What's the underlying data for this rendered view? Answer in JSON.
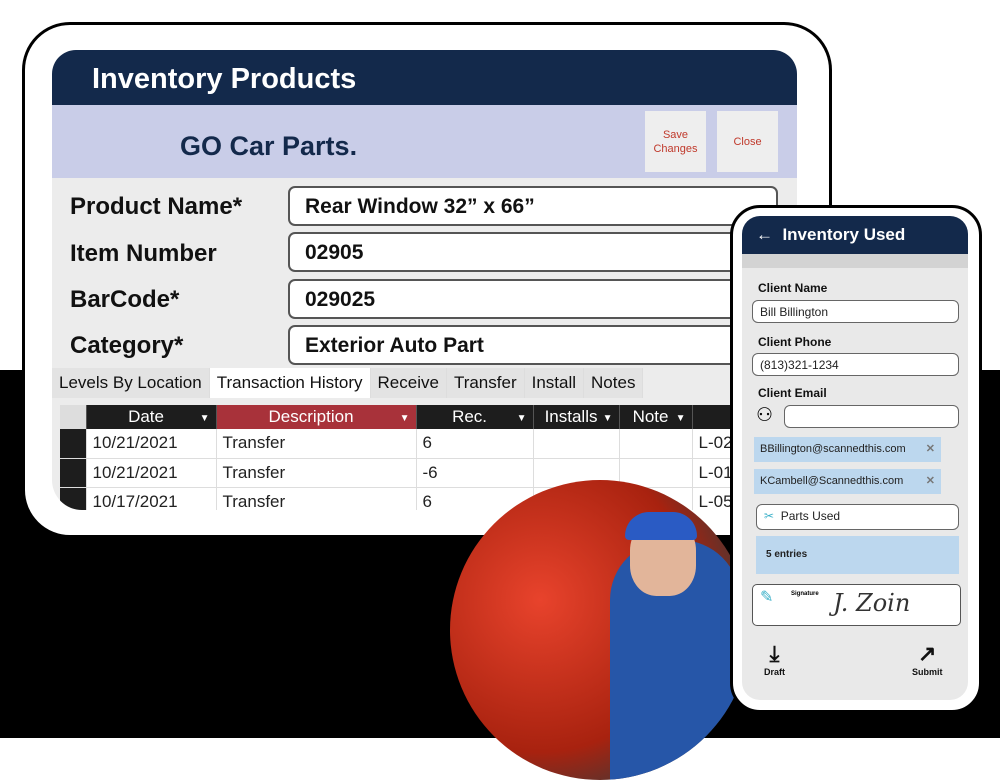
{
  "tablet": {
    "title": "Inventory Products",
    "company": "GO Car Parts.",
    "save_label": "Save Changes",
    "close_label": "Close",
    "fields": [
      {
        "label": "Product Name*",
        "value": "Rear Window 32” x 66”"
      },
      {
        "label": "Item Number",
        "value": "02905"
      },
      {
        "label": "BarCode*",
        "value": "029025"
      },
      {
        "label": "Category*",
        "value": "Exterior Auto Part"
      }
    ],
    "tabs": [
      "Levels By Location",
      "Transaction History",
      "Receive",
      "Transfer",
      "Install",
      "Notes"
    ],
    "active_tab": "Transaction History",
    "columns": [
      "Date",
      "Description",
      "Rec.",
      "Installs",
      "Note"
    ],
    "rows": [
      [
        "10/21/2021",
        "Transfer",
        "6",
        "",
        "",
        "L-02"
      ],
      [
        "10/21/2021",
        "Transfer",
        "-6",
        "",
        "",
        "L-01"
      ],
      [
        "10/17/2021",
        "Transfer",
        "6",
        "",
        "",
        "L-05"
      ]
    ]
  },
  "phone": {
    "title": "Inventory Used",
    "client_name_label": "Client Name",
    "client_name": "Bill Billington",
    "client_phone_label": "Client Phone",
    "client_phone": "(813)321-1234",
    "client_email_label": "Client Email",
    "emails": [
      "BBillington@scannedthis.com",
      "KCambell@Scannedthis.com"
    ],
    "parts_used": "Parts Used",
    "entries": "5 entries",
    "signature_label": "Signature",
    "signature": "J. Zoin",
    "draft_label": "Draft",
    "submit_label": "Submit"
  },
  "colors": {
    "navy": "#13294b",
    "accent_red": "#a8323a",
    "chip_blue": "#bcd7ee"
  }
}
